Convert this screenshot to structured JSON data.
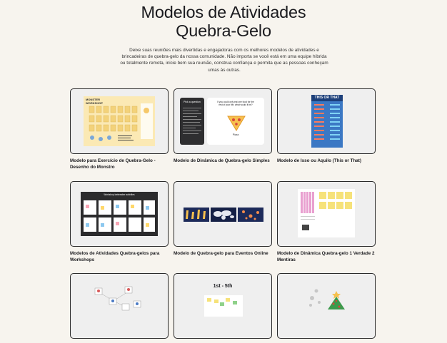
{
  "page": {
    "title_line1": "Modelos de Atividades",
    "title_line2": "Quebra-Gelo",
    "description": "Deixe suas reuniões mais divertidas e engajadoras com os melhores modelos de atividades e brincadeiras de quebra-gelo da nossa comunidade. Não importa se você está em uma equipe híbrida ou totalmente remota, inicie bem sua reunião, construa confiança e permita que as pessoas conheçam umas às outras."
  },
  "templates": [
    {
      "title": "Modelo para Exercício de Quebra-Gelo - Desenho do Monstro",
      "thumb_text": "MONSTER WORKSHOP"
    },
    {
      "title": "Modelo de Dinâmica de Quebra-gelo Simples",
      "thumb_text": "Pick a question",
      "thumb_text2": "If you could only eat one food for the rest of your life, what would it be?",
      "thumb_text3": "Pizza"
    },
    {
      "title": "Modelo de Isso ou Aquilo (This or That)",
      "thumb_text": "THIS OR THAT"
    },
    {
      "title": "Modelos de Atividades Quebra-gelos para Workshops",
      "thumb_text": "Workshop icebreaker activities"
    },
    {
      "title": "Modelo de Quebra-gelo para Eventos Online",
      "thumb_text": ""
    },
    {
      "title": "Modelo de Dinâmica Quebra-gelo 1 Verdade 2 Mentiras",
      "thumb_text": ""
    },
    {
      "title": "",
      "thumb_text": ""
    },
    {
      "title": "",
      "thumb_text": "1st - 5th"
    },
    {
      "title": "",
      "thumb_text": ""
    }
  ]
}
